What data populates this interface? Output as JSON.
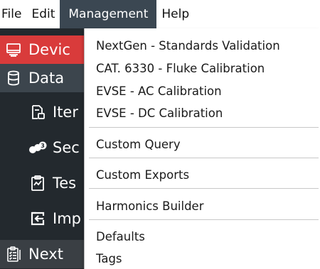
{
  "menubar": {
    "items": [
      {
        "label": "File"
      },
      {
        "label": "Edit"
      },
      {
        "label": "Management"
      },
      {
        "label": "Help"
      }
    ]
  },
  "sidebar": {
    "items": [
      {
        "label": "Devic",
        "icon": "monitor-icon"
      },
      {
        "label": "Data",
        "icon": "database-icon"
      },
      {
        "label": "Iter",
        "icon": "file-list-icon"
      },
      {
        "label": "Sec",
        "icon": "numbers-icon"
      },
      {
        "label": "Tes",
        "icon": "clipboard-icon"
      },
      {
        "label": "Imp",
        "icon": "import-icon"
      },
      {
        "label": "Next",
        "icon": "checklist-icon"
      }
    ]
  },
  "management_menu": {
    "items": [
      "NextGen - Standards Validation",
      "CAT. 6330 - Fluke Calibration",
      "EVSE - AC Calibration",
      "EVSE - DC Calibration",
      "Custom Query",
      "Custom Exports",
      "Harmonics Builder",
      "Defaults",
      "Tags"
    ]
  },
  "colors": {
    "menu_active_bg": "#3b4752",
    "sidebar_bg": "#23292e",
    "sidebar_selected_bg": "#d93b3b",
    "sidebar_group_bg": "#3c454d"
  }
}
